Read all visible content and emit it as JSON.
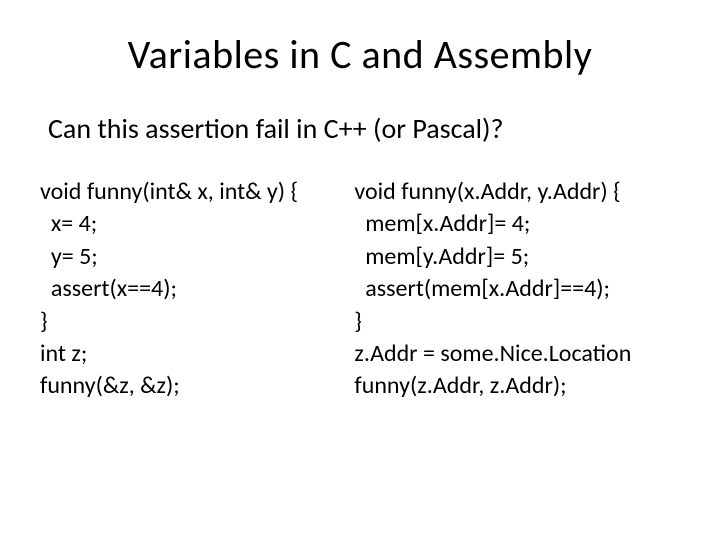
{
  "slide": {
    "title": "Variables in C and Assembly",
    "subtitle": "Can this assertion fail in C++ (or Pascal)?",
    "leftCode": "void funny(int& x, int& y) {\n  x= 4;\n  y= 5;\n  assert(x==4);\n}\nint z;\nfunny(&z, &z);",
    "rightCode": "void funny(x.Addr, y.Addr) {\n  mem[x.Addr]= 4;\n  mem[y.Addr]= 5;\n  assert(mem[x.Addr]==4);\n}\nz.Addr = some.Nice.Location\nfunny(z.Addr, z.Addr);"
  }
}
